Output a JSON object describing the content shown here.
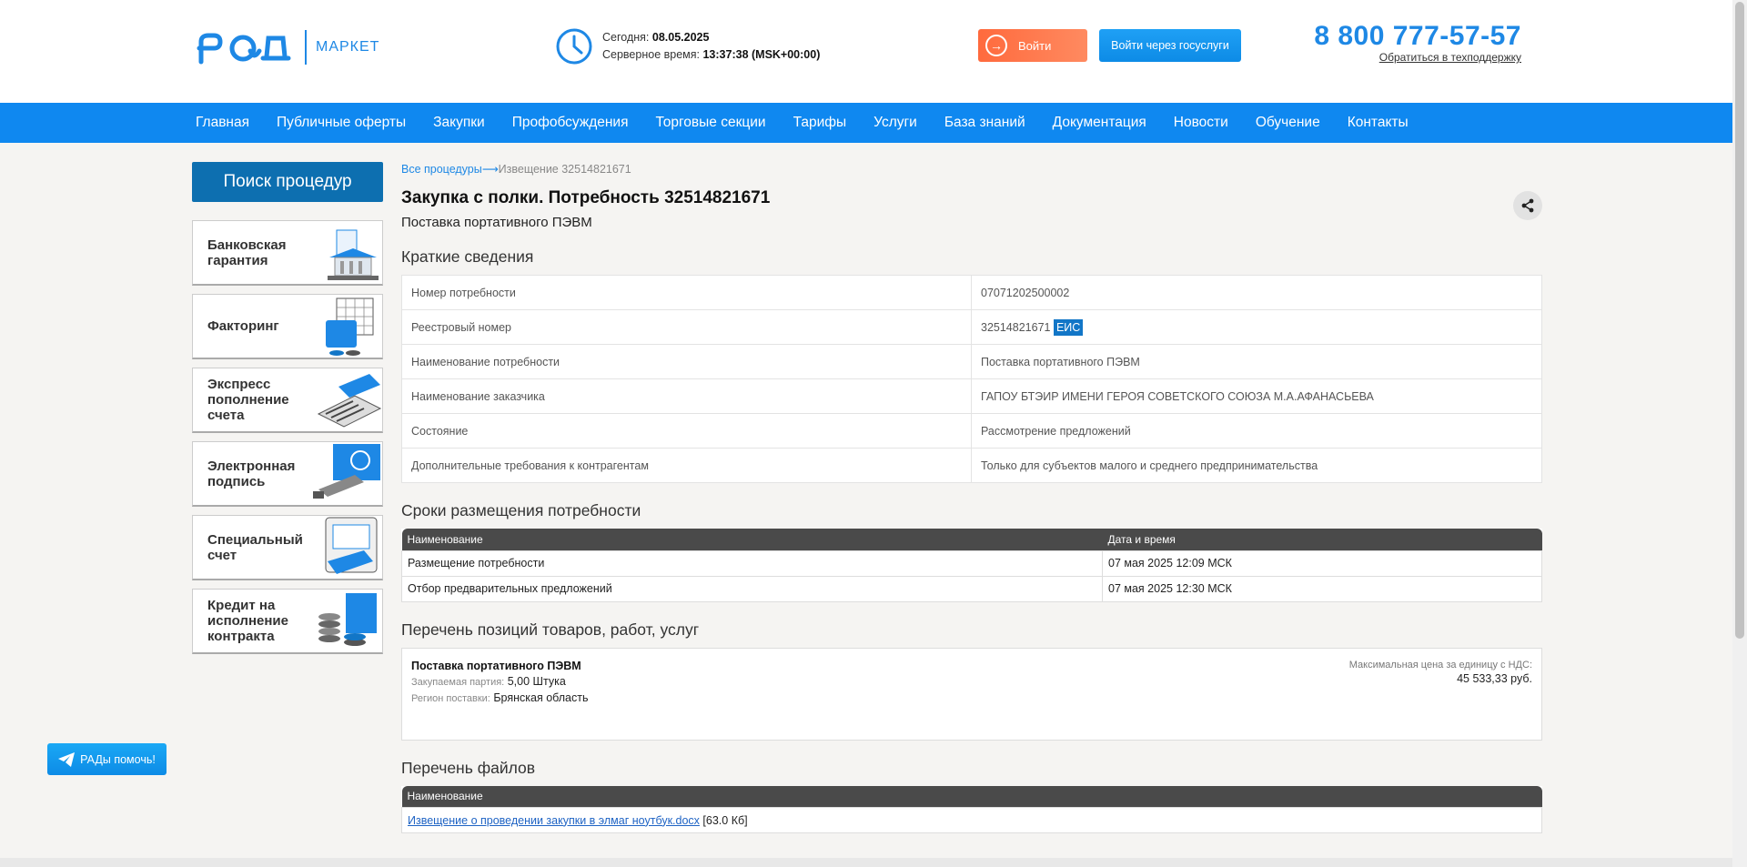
{
  "header": {
    "logo_market": "МАРКЕТ",
    "today_label": "Сегодня:",
    "today_value": "08.05.2025",
    "server_time_label": "Серверное время:",
    "server_time_value": "13:37:38 (MSK+00:00)",
    "login_label": "Войти",
    "gosuslugi_label": "Войти через госуслуги",
    "phone": "8 800 777-57-57",
    "support_link": "Обратиться в техподдержку"
  },
  "nav": {
    "items": [
      "Главная",
      "Публичные оферты",
      "Закупки",
      "Профобсуждения",
      "Торговые секции",
      "Тарифы",
      "Услуги",
      "База знаний",
      "Документация",
      "Новости",
      "Обучение",
      "Контакты"
    ]
  },
  "sidebar": {
    "search_label": "Поиск процедур",
    "promos": [
      {
        "label": "Банковская гарантия"
      },
      {
        "label": "Факторинг"
      },
      {
        "label": "Экспресс пополнение счета"
      },
      {
        "label": "Электронная подпись"
      },
      {
        "label": "Специальный счет"
      },
      {
        "label": "Кредит на исполнение контракта"
      }
    ],
    "help_label": "РАДы помочь!"
  },
  "breadcrumb": {
    "root": "Все процедуры",
    "arrow": "⟶",
    "current": "Извещение 32514821671"
  },
  "page": {
    "title": "Закупка с полки. Потребность 32514821671",
    "subtitle": "Поставка портативного ПЭВМ"
  },
  "summary": {
    "title": "Краткие сведения",
    "rows": [
      {
        "key": "Номер потребности",
        "value": "07071202500002"
      },
      {
        "key": "Реестровый номер",
        "value": "32514821671",
        "badge": "ЕИС"
      },
      {
        "key": "Наименование потребности",
        "value": "Поставка портативного ПЭВМ"
      },
      {
        "key": "Наименование заказчика",
        "value": "ГАПОУ БТЭИР ИМЕНИ ГЕРОЯ СОВЕТСКОГО СОЮЗА М.А.АФАНАСЬЕВА"
      },
      {
        "key": "Состояние",
        "value": "Рассмотрение предложений"
      },
      {
        "key": "Дополнительные требования к контрагентам",
        "value": "Только для субъектов малого и среднего предпринимательства"
      }
    ]
  },
  "deadlines": {
    "title": "Сроки размещения потребности",
    "columns": [
      "Наименование",
      "Дата и время"
    ],
    "rows": [
      {
        "name": "Размещение потребности",
        "date": "07 мая 2025 12:09 МСК"
      },
      {
        "name": "Отбор предварительных предложений",
        "date": "07 мая 2025 12:30 МСК"
      }
    ]
  },
  "positions": {
    "title": "Перечень позиций товаров, работ, услуг",
    "item_name": "Поставка портативного ПЭВМ",
    "batch_label": "Закупаемая партия:",
    "batch_value": "5,00 Штука",
    "region_label": "Регион поставки:",
    "region_value": "Брянская область",
    "price_label": "Максимальная цена за единицу с НДС:",
    "price_value": "45 533,33 руб."
  },
  "files": {
    "title": "Перечень файлов",
    "column": "Наименование",
    "file_name": "Извещение о проведении закупки в элмаг ноутбук.docx",
    "file_size": "[63.0 Кб]"
  },
  "colors": {
    "brand": "#1e88e5",
    "nav": "#0f88f0",
    "login": "#ff6a3d",
    "dark_header": "#4a4a4a"
  }
}
